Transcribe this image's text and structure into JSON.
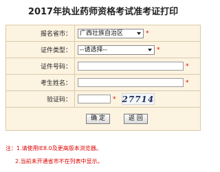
{
  "title": "2017年执业药师资格考试准考证打印",
  "form": {
    "province_label": "报名省市：",
    "province_value": "广西壮族自治区",
    "cert_type_label": "证件类型：",
    "cert_type_value": "--请选择--",
    "id_number_label": "证件号码：",
    "id_number_value": "",
    "name_label": "考生姓名：",
    "name_value": "",
    "captcha_label": "验证码：",
    "captcha_value": "",
    "captcha_text": "27714",
    "required_mark": "*"
  },
  "buttons": {
    "confirm": "确 定",
    "back": "返 回"
  },
  "notes": {
    "line1": "注：1.请使用IE8.0及更高版本浏览器。",
    "line2": "2.当前未开通省市不在列表中显示。"
  },
  "colors": {
    "row_background": "#fdf3e1",
    "border": "#d9c9a8",
    "required": "#e00000"
  }
}
